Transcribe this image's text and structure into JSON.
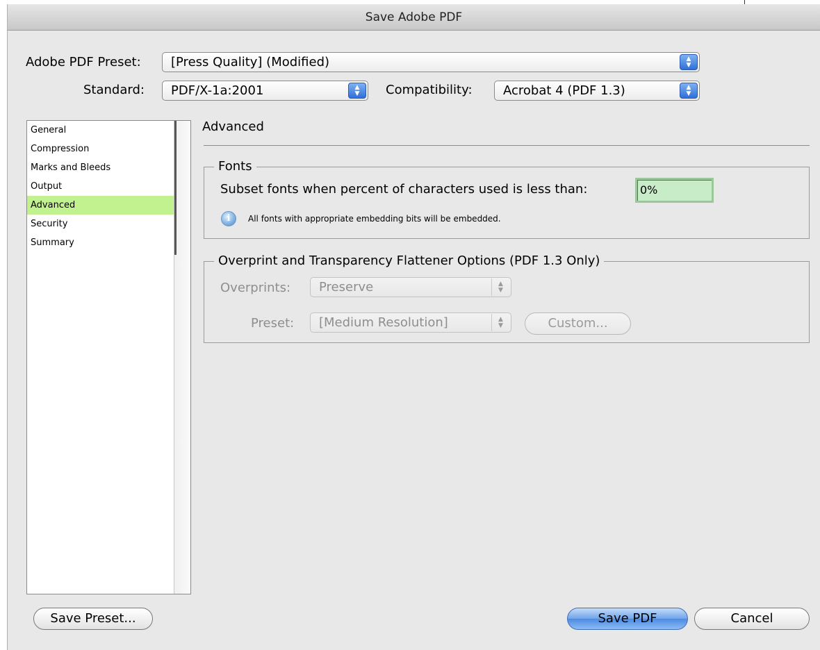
{
  "window": {
    "title": "Save Adobe PDF"
  },
  "preset": {
    "label": "Adobe PDF Preset:",
    "value": "[Press Quality] (Modified)"
  },
  "standard": {
    "label": "Standard:",
    "value": "PDF/X-1a:2001"
  },
  "compatibility": {
    "label": "Compatibility:",
    "value": "Acrobat 4 (PDF 1.3)"
  },
  "sidebar": {
    "items": [
      {
        "label": "General"
      },
      {
        "label": "Compression"
      },
      {
        "label": "Marks and Bleeds"
      },
      {
        "label": "Output"
      },
      {
        "label": "Advanced"
      },
      {
        "label": "Security"
      },
      {
        "label": "Summary"
      }
    ],
    "selected": "Advanced"
  },
  "main": {
    "section_title": "Advanced",
    "fonts": {
      "legend": "Fonts",
      "subset_label": "Subset fonts when percent of characters used is less than:",
      "subset_value": "0%",
      "info_text": "All fonts with appropriate embedding bits will be embedded."
    },
    "overprint": {
      "legend": "Overprint and Transparency Flattener Options (PDF 1.3 Only)",
      "overprints_label": "Overprints:",
      "overprints_value": "Preserve",
      "preset_label": "Preset:",
      "preset_value": "[Medium Resolution]",
      "custom_label": "Custom..."
    }
  },
  "footer": {
    "save_preset_label": "Save Preset...",
    "save_pdf_label": "Save PDF",
    "cancel_label": "Cancel"
  },
  "icons": {
    "popup_arrows": "up-down-arrows-icon",
    "info": "info-icon"
  },
  "colors": {
    "selected_item": "#c2f190",
    "input_bg": "#c8ecc8",
    "default_button": "#4c8be2"
  }
}
